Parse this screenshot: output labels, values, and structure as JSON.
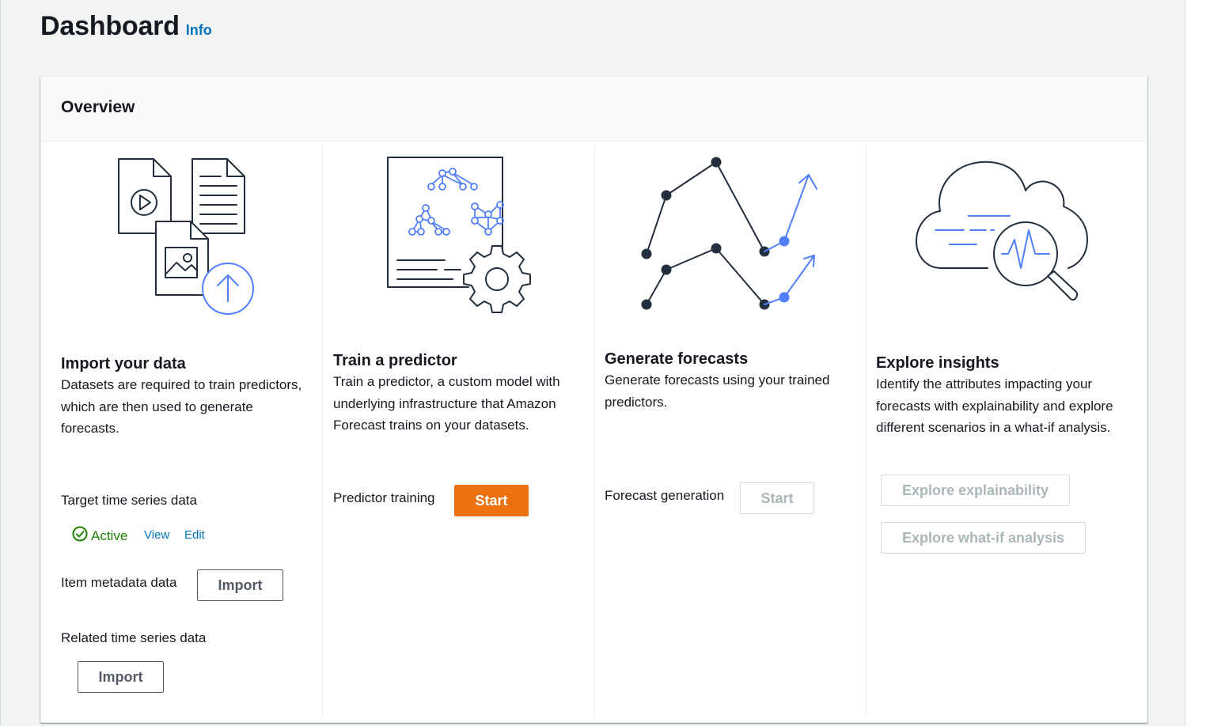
{
  "page": {
    "title": "Dashboard",
    "info_link": "Info"
  },
  "overview": {
    "title": "Overview",
    "import": {
      "title": "Import your data",
      "description": "Datasets are required to train predictors, which are then used to generate forecasts.",
      "target": {
        "label": "Target time series data",
        "status": "Active",
        "view_link": "View",
        "edit_link": "Edit"
      },
      "item_metadata": {
        "label": "Item metadata data",
        "button": "Import"
      },
      "related": {
        "label": "Related time series data",
        "button": "Import"
      }
    },
    "train": {
      "title": "Train a predictor",
      "description": "Train a predictor, a custom model with underlying infrastructure that Amazon Forecast trains on your datasets.",
      "row_label": "Predictor training",
      "button": "Start"
    },
    "forecast": {
      "title": "Generate forecasts",
      "description": "Generate forecasts using your trained predictors.",
      "row_label": "Forecast generation",
      "button": "Start"
    },
    "insights": {
      "title": "Explore insights",
      "description": "Identify the attributes impacting your forecasts with explainability and explore different scenarios in a what-if analysis.",
      "explainability_button": "Explore explainability",
      "whatif_button": "Explore what-if analysis"
    }
  },
  "icons": {
    "import_illustration": "import-data-icon",
    "train_illustration": "train-predictor-icon",
    "forecast_illustration": "forecast-chart-icon",
    "insights_illustration": "cloud-insights-icon",
    "status_icon": "check-circle-icon"
  },
  "colors": {
    "primary_button": "#ec7211",
    "link": "#0073bb",
    "success": "#1d8102",
    "illustration_dark": "#232f3e",
    "illustration_accent": "#527fff"
  }
}
